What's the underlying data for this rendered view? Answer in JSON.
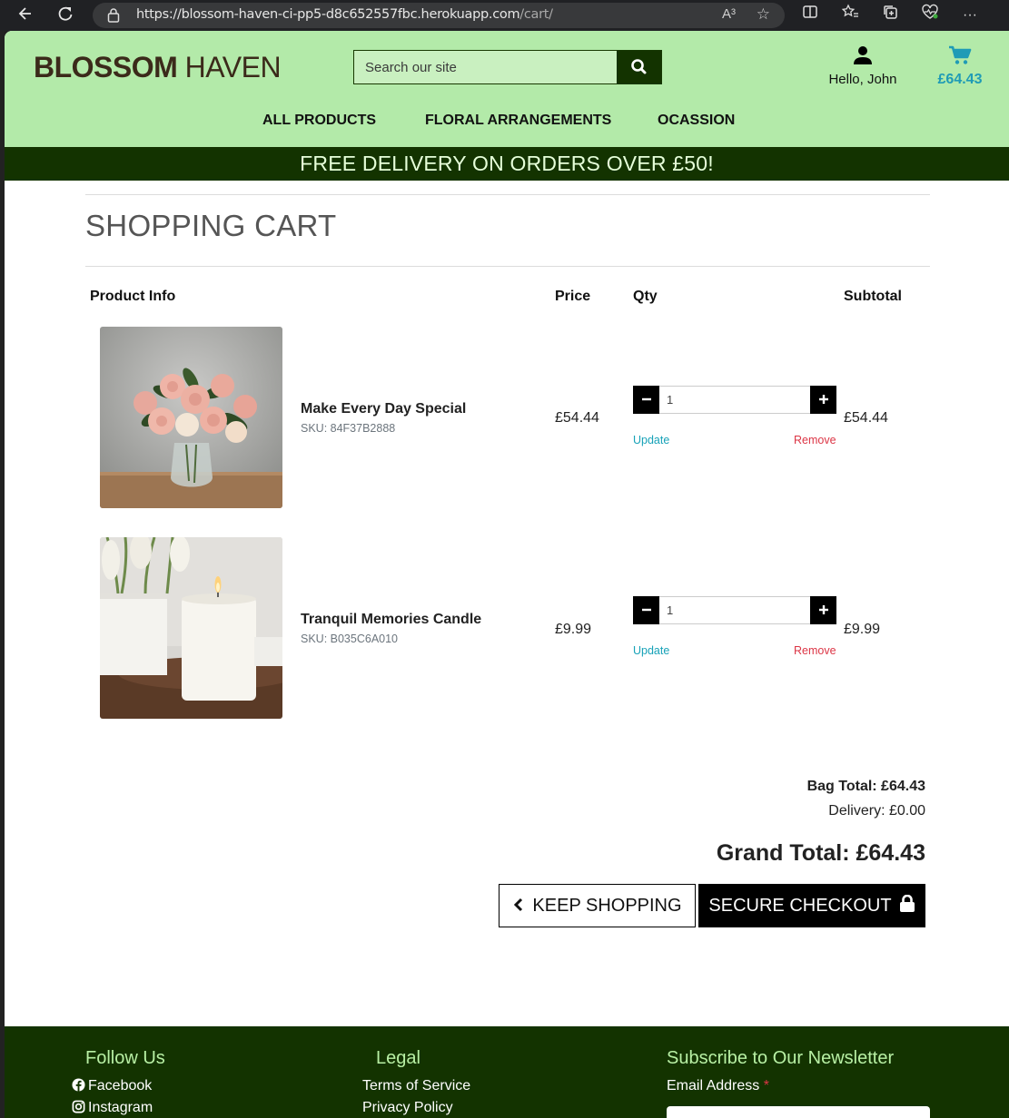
{
  "browser": {
    "url_host": "https://blossom-haven-ci-pp5-d8c652557fbc.herokuapp.com",
    "url_path": "/cart/",
    "read_aloud_label": "A³"
  },
  "header": {
    "logo_bold": "BLOSSOM",
    "logo_light": " HAVEN",
    "search_placeholder": "Search our site",
    "greeting": "Hello, John",
    "cart_total": "£64.43",
    "nav": [
      "ALL PRODUCTS",
      "FLORAL ARRANGEMENTS",
      "OCASSION"
    ]
  },
  "promo_banner": "FREE DELIVERY ON ORDERS OVER £50!",
  "cart": {
    "title": "SHOPPING CART",
    "columns": [
      "Product Info",
      "Price",
      "Qty",
      "Subtotal"
    ],
    "items": [
      {
        "name": "Make Every Day Special",
        "sku": "SKU: 84F37B2888",
        "price": "£54.44",
        "qty": "1",
        "subtotal": "£54.44",
        "update_label": "Update",
        "remove_label": "Remove"
      },
      {
        "name": "Tranquil Memories Candle",
        "sku": "SKU: B035C6A010",
        "price": "£9.99",
        "qty": "1",
        "subtotal": "£9.99",
        "update_label": "Update",
        "remove_label": "Remove"
      }
    ],
    "bag_total": "Bag Total: £64.43",
    "delivery": "Delivery: £0.00",
    "grand_total": "Grand Total: £64.43",
    "keep_shopping": "KEEP SHOPPING",
    "checkout": "SECURE CHECKOUT"
  },
  "footer": {
    "follow_title": "Follow Us",
    "follow_links": [
      "Facebook",
      "Instagram"
    ],
    "legal_title": "Legal",
    "legal_links": [
      "Terms of Service",
      "Privacy Policy"
    ],
    "newsletter_title": "Subscribe to Our Newsletter",
    "email_label": "Email Address",
    "required_mark": "*"
  },
  "colors": {
    "header_bg": "#b3eaa9",
    "dark_green": "#133300",
    "accent_cyan": "#1f9bb6",
    "remove_red": "#dc3545"
  }
}
